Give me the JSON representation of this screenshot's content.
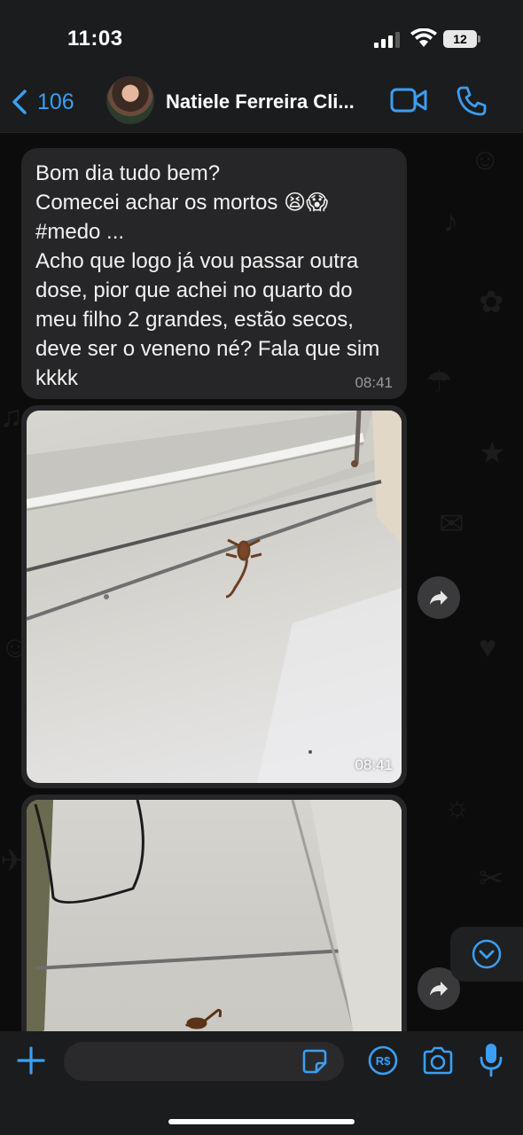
{
  "status_bar": {
    "time": "11:03",
    "battery": "12"
  },
  "header": {
    "back_count": "106",
    "contact_name": "Natiele Ferreira Cli..."
  },
  "messages": [
    {
      "type": "text",
      "text": "Bom dia tudo bem?\nComecei achar os mortos 😫😱\n#medo ...\nAcho que logo já vou passar outra dose, pior que achei no quarto do meu filho 2 grandes, estão secos, deve ser o veneno né? Fala que sim kkkk",
      "time": "08:41"
    },
    {
      "type": "image",
      "time": "08:41"
    },
    {
      "type": "image",
      "time": ""
    }
  ],
  "input": {
    "placeholder": ""
  },
  "icons": {
    "back": "chevron-left-icon",
    "video": "video-camera-icon",
    "call": "phone-icon",
    "forward": "forward-arrow-icon",
    "scroll_down": "chevron-down-circle-icon",
    "plus": "plus-icon",
    "sticker": "sticker-icon",
    "pay": "payment-icon",
    "camera": "camera-icon",
    "mic": "microphone-icon"
  },
  "colors": {
    "accent": "#3a9ff5",
    "bubble": "#262628",
    "bar": "#1b1c1e"
  }
}
